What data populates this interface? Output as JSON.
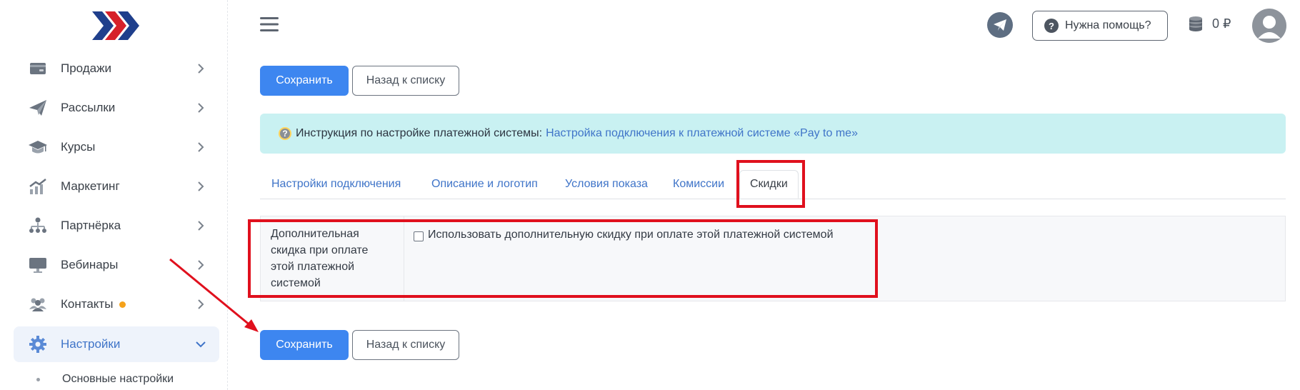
{
  "sidebar": {
    "items": [
      {
        "label": "Продажи",
        "icon": "wallet-icon"
      },
      {
        "label": "Рассылки",
        "icon": "paper-plane-icon"
      },
      {
        "label": "Курсы",
        "icon": "graduation-cap-icon"
      },
      {
        "label": "Маркетинг",
        "icon": "chart-growth-icon"
      },
      {
        "label": "Партнёрка",
        "icon": "partner-network-icon"
      },
      {
        "label": "Вебинары",
        "icon": "monitor-icon"
      },
      {
        "label": "Контакты",
        "icon": "users-icon"
      },
      {
        "label": "Настройки",
        "icon": "gear-icon"
      }
    ],
    "subitem": "Основные настройки"
  },
  "header": {
    "help": "Нужна помощь?",
    "balance": "0 ₽"
  },
  "buttons": {
    "save": "Сохранить",
    "back": "Назад к списку"
  },
  "banner": {
    "text": "Инструкция по настройке платежной системы:",
    "link": "Настройка подключения к платежной системе «Pay to me»"
  },
  "tabs": [
    "Настройки подключения",
    "Описание и логотип",
    "Условия показа",
    "Комиссии",
    "Скидки"
  ],
  "form": {
    "label": "Дополнительная скидка при оплате этой платежной системой",
    "checkbox": "Использовать дополнительную скидку при оплате этой платежной системой"
  },
  "colors": {
    "primary": "#3d86f0",
    "link": "#3f74c8",
    "banner": "#c9f1f2",
    "annotation": "#e0101d"
  }
}
